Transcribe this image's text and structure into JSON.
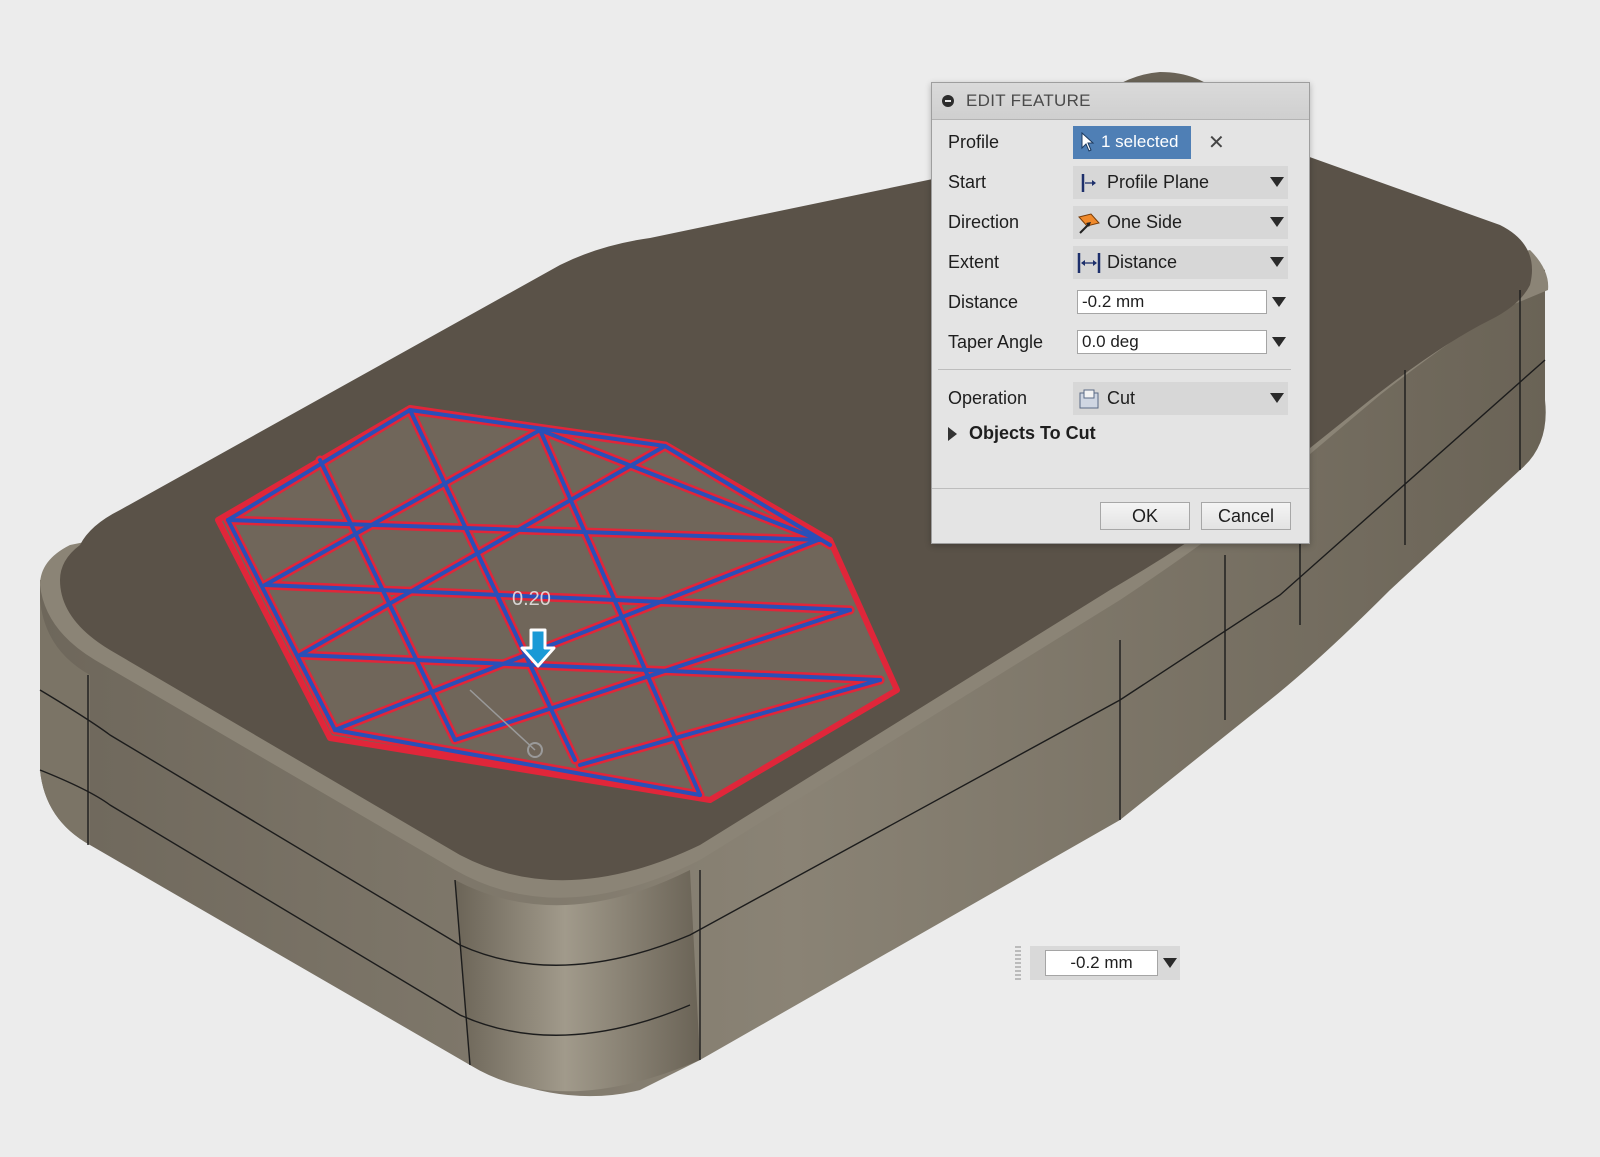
{
  "dialog": {
    "title": "EDIT FEATURE",
    "profile_label": "Profile",
    "profile_value": "1 selected",
    "clear_symbol": "✕",
    "start_label": "Start",
    "start_value": "Profile Plane",
    "direction_label": "Direction",
    "direction_value": "One Side",
    "extent_label": "Extent",
    "extent_value": "Distance",
    "distance_label": "Distance",
    "distance_value": "-0.2 mm",
    "taper_label": "Taper Angle",
    "taper_value": "0.0 deg",
    "operation_label": "Operation",
    "operation_value": "Cut",
    "objects_to_cut_label": "Objects To Cut",
    "ok_label": "OK",
    "cancel_label": "Cancel"
  },
  "viewport": {
    "floating_distance_value": "-0.2 mm",
    "dimension_label": "0.20"
  },
  "colors": {
    "selection_blue": "#4f7fb5",
    "sketch_red": "#e0263a",
    "sketch_blue": "#2a4fb8",
    "body_top": "#5a5248",
    "body_side": "#7d7668",
    "manipulator_arrow": "#1a9ad6"
  },
  "icons": [
    "collapse-icon",
    "cursor-icon",
    "profile-plane-icon",
    "one-side-icon",
    "distance-extent-icon",
    "cut-icon",
    "expand-triangle-icon",
    "dropdown-arrow-icon",
    "distance-manipulator-arrow-icon"
  ]
}
